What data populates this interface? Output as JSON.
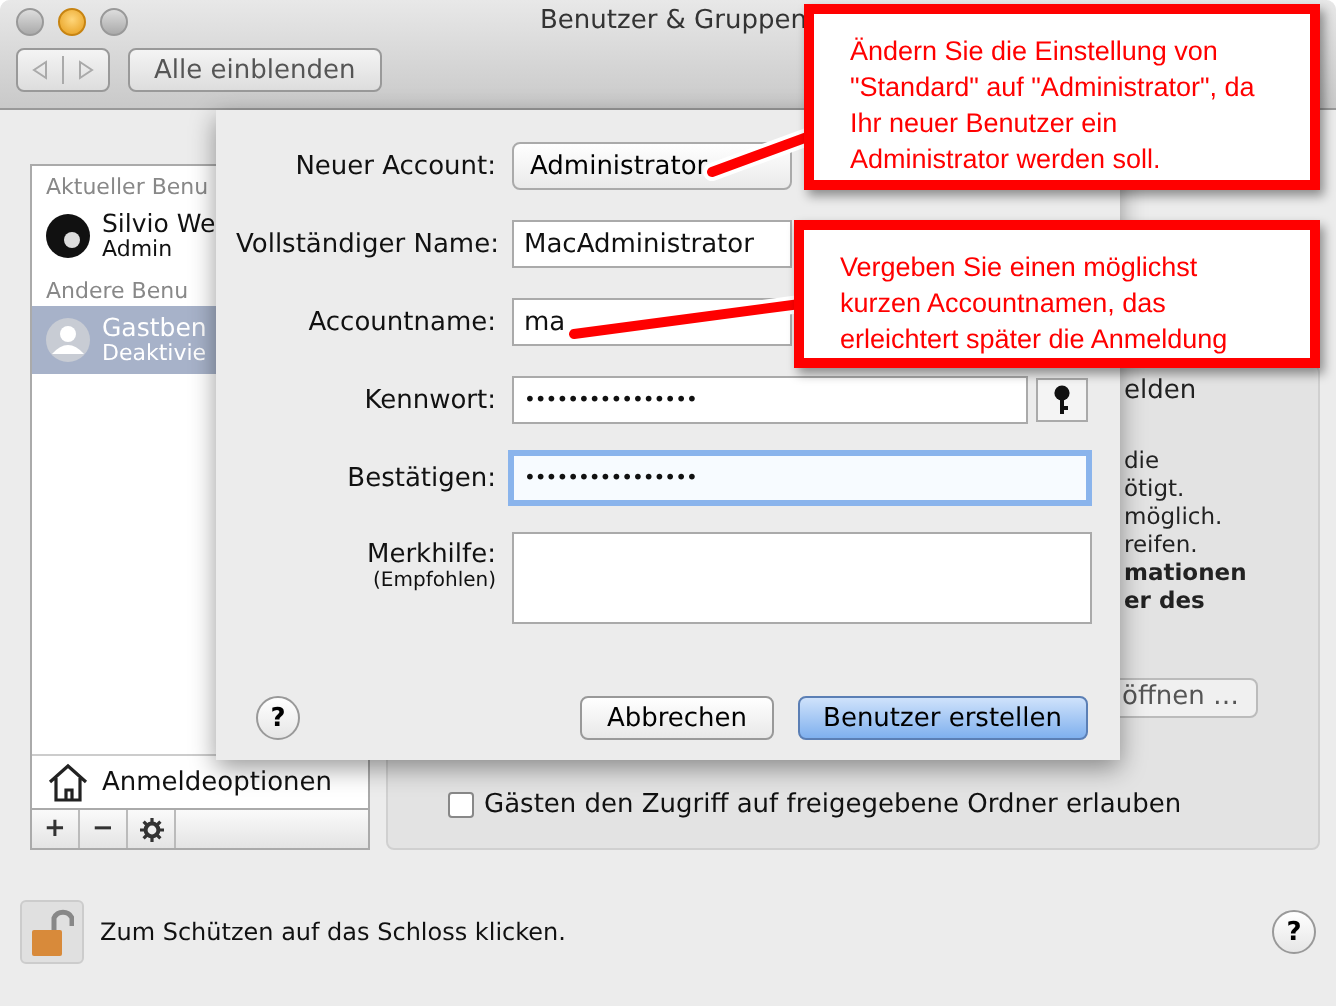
{
  "window": {
    "title": "Benutzer & Gruppen"
  },
  "toolbar": {
    "show_all": "Alle einblenden"
  },
  "sidebar": {
    "sections": [
      {
        "heading": "Aktueller Benu",
        "users": [
          {
            "name": "Silvio We",
            "role": "Admin",
            "kind": "admin",
            "selected": false
          }
        ]
      },
      {
        "heading": "Andere Benu",
        "users": [
          {
            "name": "Gastben",
            "role": "Deaktivie",
            "kind": "guest",
            "selected": true
          }
        ]
      }
    ],
    "login_options": "Anmeldeoptionen",
    "buttons": [
      "+",
      "−"
    ]
  },
  "guest_panel": {
    "fragments": [
      {
        "text": "elden",
        "kind": "text"
      },
      {
        "text": "die",
        "kind": "small"
      },
      {
        "text": "ötigt.",
        "kind": "small"
      },
      {
        "text": "möglich.",
        "kind": "small"
      },
      {
        "text": "reifen.",
        "kind": "small"
      },
      {
        "text": "mationen",
        "kind": "bold"
      },
      {
        "text": "er des",
        "kind": "bold"
      },
      {
        "text": "öffnen …",
        "kind": "button"
      }
    ],
    "share_checkbox": {
      "label": "Gästen den Zugriff auf freigegebene Ordner erlauben",
      "checked": false
    }
  },
  "sheet": {
    "fields": [
      {
        "label": "Neuer Account:",
        "kind": "popup",
        "value": "Administrator"
      },
      {
        "label": "Vollständiger Name:",
        "kind": "text",
        "value": "MacAdministrator",
        "focused": false
      },
      {
        "label": "Accountname:",
        "kind": "text",
        "value": "ma",
        "focused": false
      },
      {
        "label": "Kennwort:",
        "kind": "password_key",
        "value": "••••••••••••••••",
        "focused": false
      },
      {
        "label": "Bestätigen:",
        "kind": "password",
        "value": "••••••••••••••••",
        "focused": true
      }
    ],
    "hint": {
      "label": "Merkhilfe:",
      "sublabel": "(Empfohlen)"
    },
    "help": "?",
    "buttons": [
      {
        "label": "Abbrechen",
        "default": false
      },
      {
        "label": "Benutzer erstellen",
        "default": true
      }
    ]
  },
  "footer": {
    "lock_text": "Zum Schützen auf das Schloss klicken.",
    "help": "?"
  },
  "callouts": [
    {
      "text": "Ändern Sie die Einstellung von \"Standard\" auf \"Administrator\", da Ihr neuer Benutzer ein Administrator werden soll."
    },
    {
      "text": "Vergeben Sie einen möglichst kurzen Accountnamen, das erleichtert später die Anmeldung"
    }
  ]
}
